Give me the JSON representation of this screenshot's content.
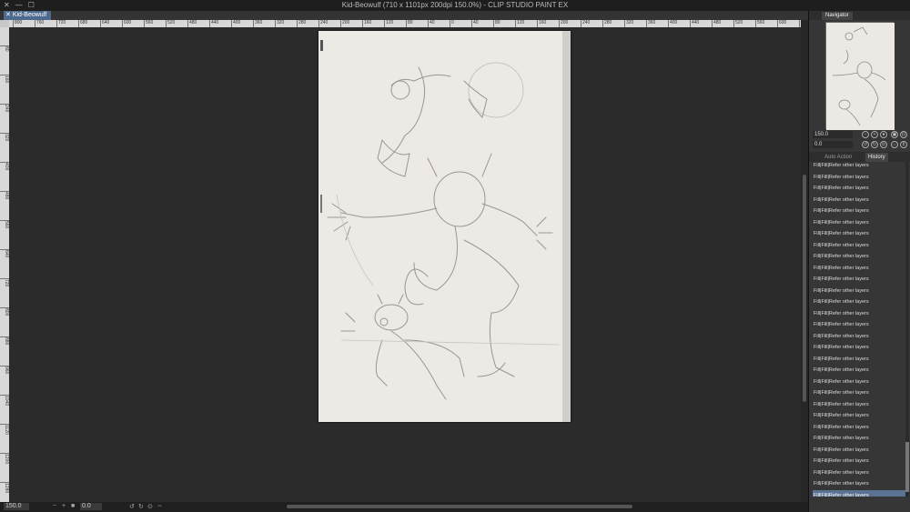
{
  "window": {
    "title": "Kid-Beowulf (710 x 1101px 200dpi 150.0%)  - CLIP STUDIO PAINT EX",
    "close_glyph": "✕",
    "minimize_glyph": "—",
    "maximize_glyph": "☐"
  },
  "document_tab": {
    "label": "Kid-Beowulf",
    "close_glyph": "✕"
  },
  "ruler": {
    "horizontal_ticks": [
      "800",
      "760",
      "720",
      "680",
      "640",
      "600",
      "560",
      "520",
      "480",
      "440",
      "400",
      "360",
      "320",
      "280",
      "240",
      "200",
      "160",
      "120",
      "80",
      "40",
      "0",
      "40",
      "80",
      "120",
      "160",
      "200",
      "240",
      "280",
      "320",
      "360",
      "400",
      "440",
      "480",
      "520",
      "560",
      "600",
      "640",
      "680",
      "720",
      "760",
      "800",
      "840",
      "880",
      "920",
      "960",
      "1000",
      "1040",
      "1080",
      "1120",
      "1160",
      "1200",
      "1240",
      "1280",
      "1320"
    ],
    "vertical_ticks": [
      "80",
      "160",
      "240",
      "320",
      "400",
      "480",
      "560",
      "640",
      "720",
      "800",
      "880",
      "960",
      "1040",
      "1120",
      "1200",
      "1280"
    ]
  },
  "statusbar": {
    "zoom": "150.0",
    "rotation": "0.0",
    "icons": [
      "minus-icon",
      "plus-icon",
      "fit-icon",
      "rotate-left-icon",
      "rotate-right-icon",
      "reset-icon",
      "flip-icon"
    ]
  },
  "navigator": {
    "tab_label": "Navigator",
    "zoom_value": "150.0",
    "angle_value": "0.0"
  },
  "history_panel": {
    "tabs": [
      "Auto Action",
      "History"
    ],
    "active_tab": "History",
    "items": [
      "Fill|Fill|Refer other layers",
      "Fill|Fill|Refer other layers",
      "Fill|Fill|Refer other layers",
      "Fill|Fill|Refer other layers",
      "Fill|Fill|Refer other layers",
      "Fill|Fill|Refer other layers",
      "Fill|Fill|Refer other layers",
      "Fill|Fill|Refer other layers",
      "Fill|Fill|Refer other layers",
      "Fill|Fill|Refer other layers",
      "Fill|Fill|Refer other layers",
      "Fill|Fill|Refer other layers",
      "Fill|Fill|Refer other layers",
      "Fill|Fill|Refer other layers",
      "Fill|Fill|Refer other layers",
      "Fill|Fill|Refer other layers",
      "Fill|Fill|Refer other layers",
      "Fill|Fill|Refer other layers",
      "Fill|Fill|Refer other layers",
      "Fill|Fill|Refer other layers",
      "Fill|Fill|Refer other layers",
      "Fill|Fill|Refer other layers",
      "Fill|Fill|Refer other layers",
      "Fill|Fill|Refer other layers",
      "Fill|Fill|Refer other layers",
      "Fill|Fill|Refer other layers",
      "Fill|Fill|Refer other layers",
      "Fill|Fill|Refer other layers",
      "Fill|Fill|Refer other layers",
      "Fill|Fill|Refer other layers"
    ],
    "selected_index": 29
  },
  "colors": {
    "accent": "#5b7392",
    "tab": "#4d6a8e",
    "paper": "#ede9e5"
  }
}
